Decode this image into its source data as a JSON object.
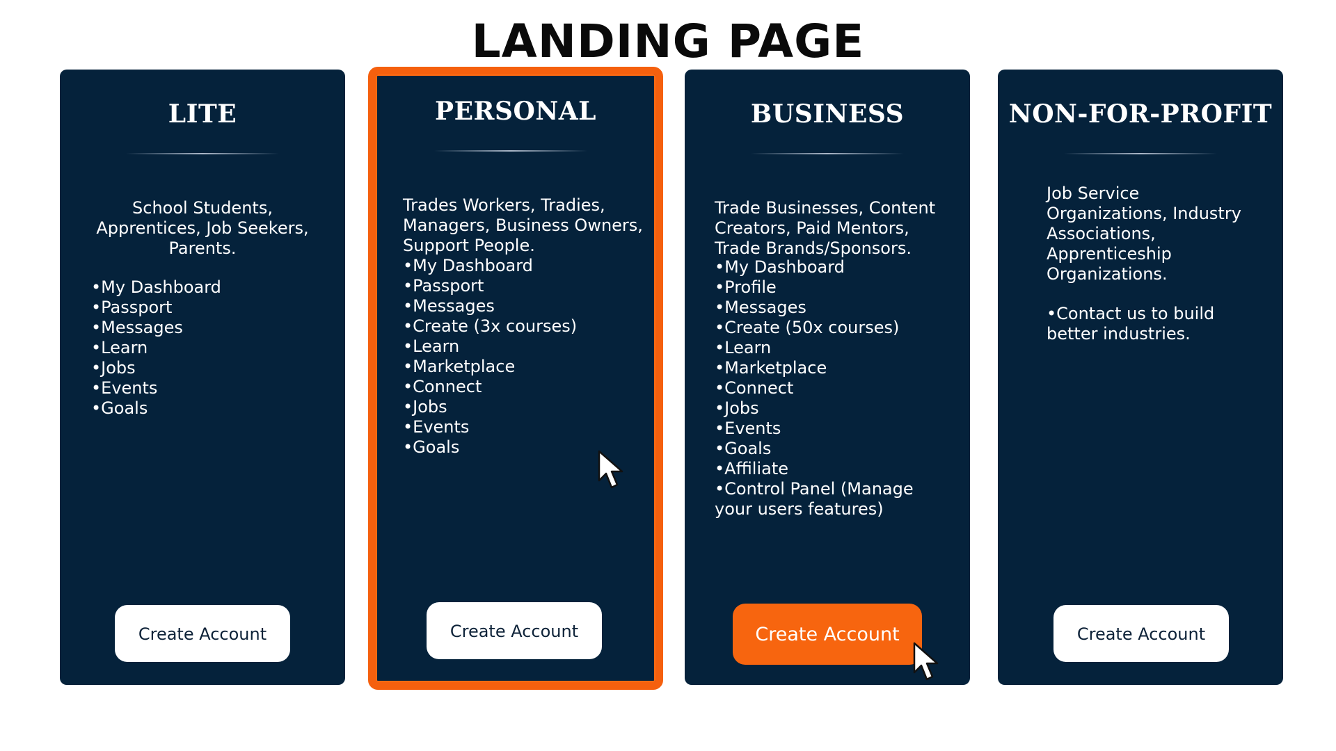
{
  "page": {
    "title": "LANDING PAGE"
  },
  "plans": [
    {
      "name": "LITE",
      "description": "School Students, Apprentices, Job Seekers, Parents.",
      "features": [
        "•My Dashboard",
        "•Passport",
        "•Messages",
        "•Learn",
        "•Jobs",
        "•Events",
        "•Goals"
      ],
      "cta": "Create Account"
    },
    {
      "name": "PERSONAL",
      "description": "Trades Workers, Tradies, Managers, Business Owners, Support People.",
      "features": [
        "•My Dashboard",
        "•Passport",
        "•Messages",
        "•Create (3x courses)",
        "•Learn",
        "•Marketplace",
        "•Connect",
        "•Jobs",
        "•Events",
        "•Goals"
      ],
      "cta": "Create Account",
      "selected": true
    },
    {
      "name": "BUSINESS",
      "description": "Trade Businesses, Content Creators, Paid Mentors, Trade Brands/Sponsors.",
      "features": [
        "•My Dashboard",
        "•Profile",
        "•Messages",
        "•Create (50x courses)",
        "•Learn",
        "•Marketplace",
        "•Connect",
        "•Jobs",
        "•Events",
        "•Goals",
        "•Affiliate",
        "•Control Panel (Manage your users features)"
      ],
      "cta": "Create Account",
      "cta_highlighted": true
    },
    {
      "name": "NON-FOR-PROFIT",
      "description": "Job Service Organizations, Industry Associations, Apprenticeship Organizations.",
      "features": [
        "•Contact us to build better industries."
      ],
      "cta": "Create Account"
    }
  ],
  "colors": {
    "card_background": "#05223b",
    "accent_orange": "#f5600e",
    "button_white": "#ffffff"
  },
  "icons": {
    "cursor": "mouse-pointer-icon"
  }
}
